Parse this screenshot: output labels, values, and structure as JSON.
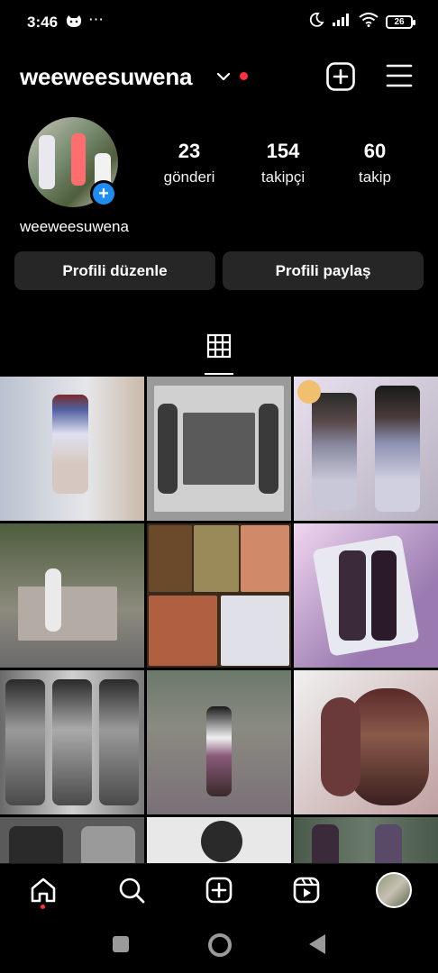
{
  "status_bar": {
    "time": "3:46",
    "dots": "⋯",
    "battery": "26"
  },
  "header": {
    "username": "weeweesuwena",
    "notification_color": "#ff3040"
  },
  "profile": {
    "display_name": "weeweesuwena",
    "stats": [
      {
        "value": "23",
        "label": "gönderi"
      },
      {
        "value": "154",
        "label": "takipçi"
      },
      {
        "value": "60",
        "label": "takip"
      }
    ]
  },
  "actions": {
    "edit_label": "Profili düzenle",
    "share_label": "Profili paylaş"
  },
  "tabs": {
    "active": "grid-icon"
  },
  "grid": {
    "posts": [
      {
        "bg": "#c9cfd6"
      },
      {
        "bg": "#8c8c8c"
      },
      {
        "bg": "#d6c9d8"
      },
      {
        "bg": "#5d6b4e"
      },
      {
        "bg": "#7a5a3a"
      },
      {
        "bg": "#caa9c9"
      },
      {
        "bg": "#b8b8b8"
      },
      {
        "bg": "#7d8676"
      },
      {
        "bg": "#c7a8a0"
      },
      {
        "bg": "#6e6e6e"
      },
      {
        "bg": "#e0e0e0"
      },
      {
        "bg": "#5a6a5a"
      }
    ]
  },
  "bottom_nav": [
    "home-icon",
    "search-icon",
    "create-icon",
    "reels-icon",
    "profile-avatar"
  ],
  "colors": {
    "accent_blue": "#1e8cf0",
    "button_bg": "#262626"
  }
}
